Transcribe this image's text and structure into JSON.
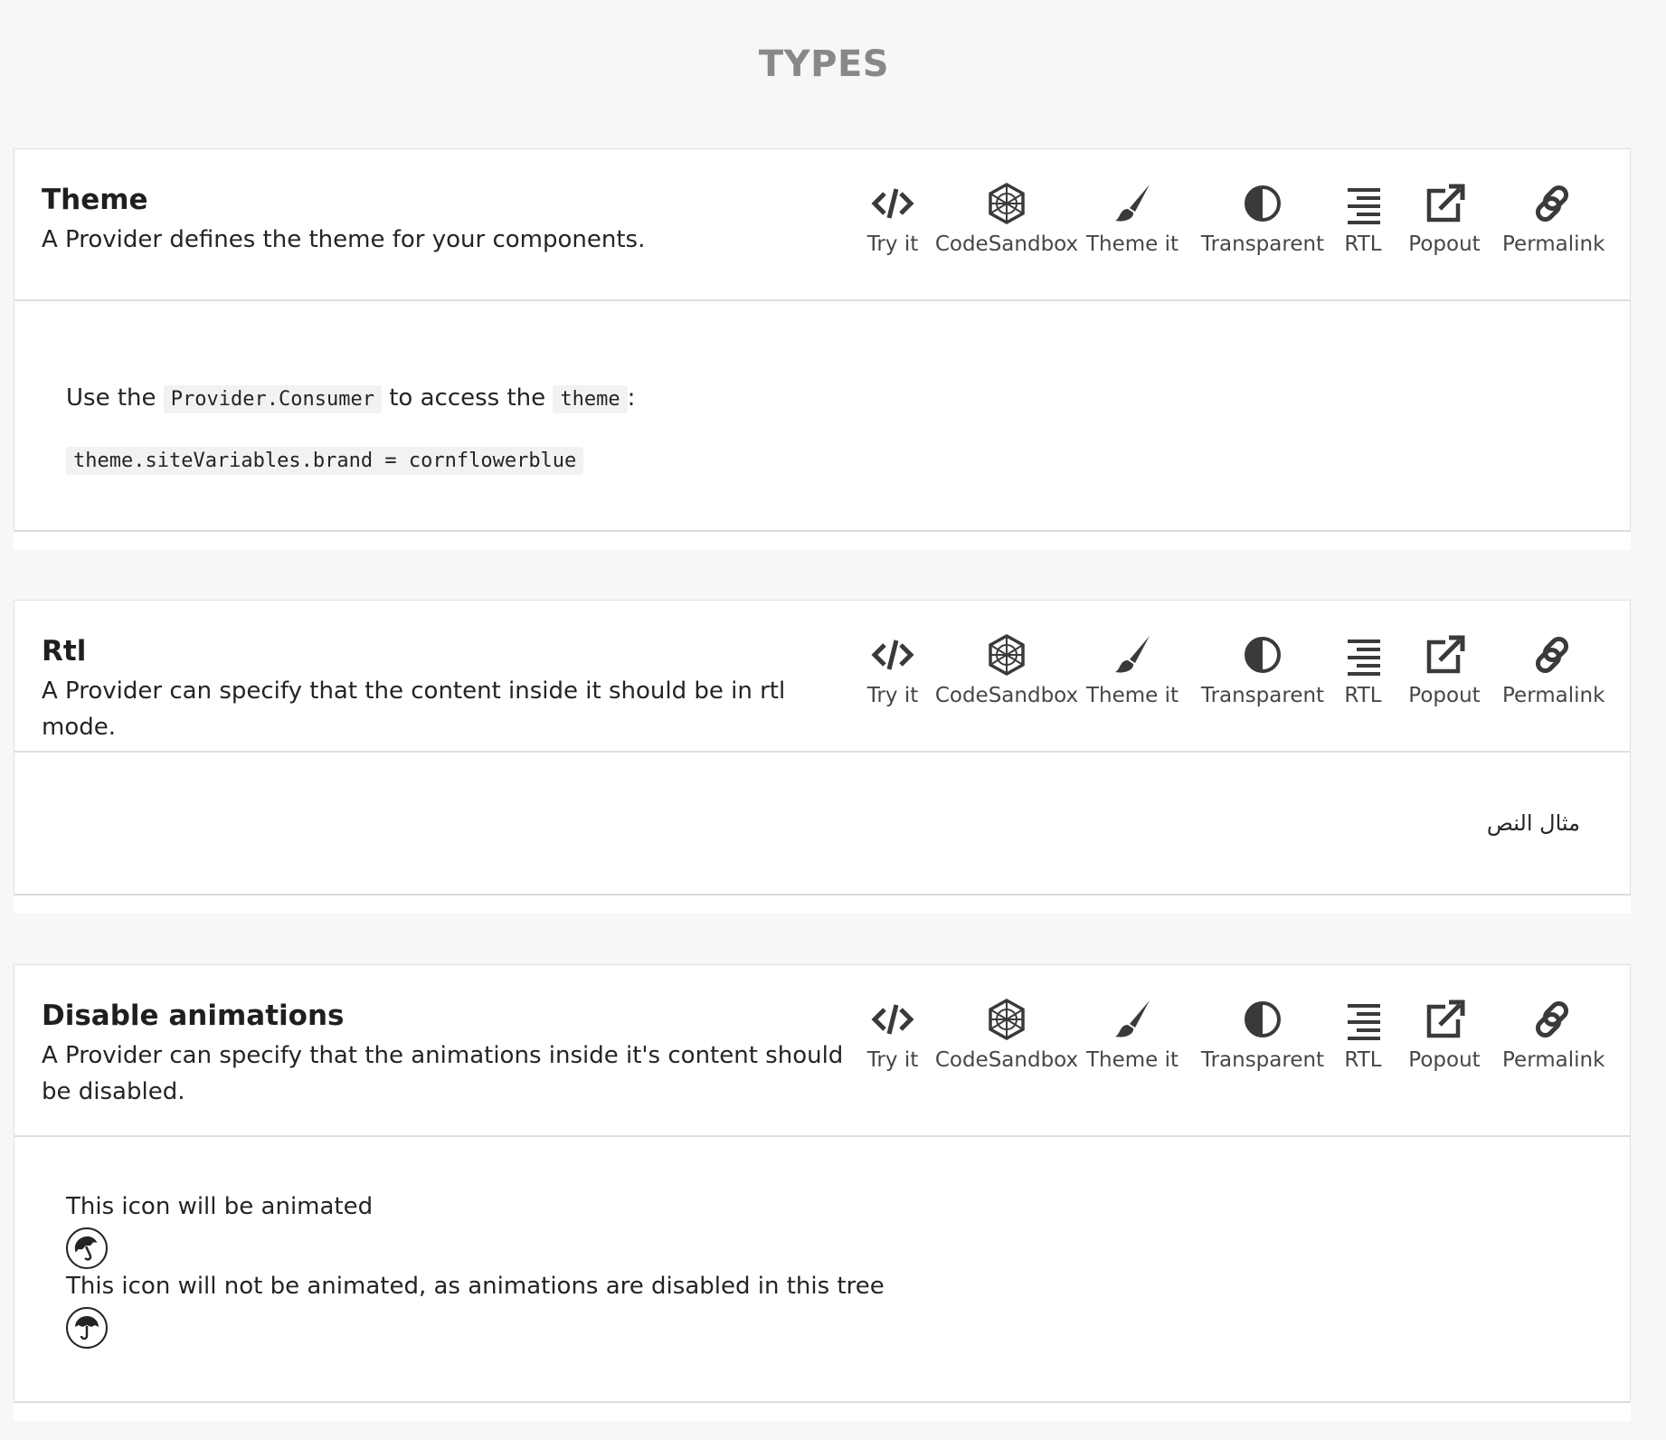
{
  "page": {
    "title": "TYPES"
  },
  "toolbar": {
    "items": [
      {
        "label": "Try it",
        "icon": "code-icon"
      },
      {
        "label": "CodeSandbox",
        "icon": "codesandbox-icon"
      },
      {
        "label": "Theme it",
        "icon": "paint-brush-icon"
      },
      {
        "label": "Transparent",
        "icon": "contrast-icon"
      },
      {
        "label": "RTL",
        "icon": "align-right-icon"
      },
      {
        "label": "Popout",
        "icon": "external-link-icon"
      },
      {
        "label": "Permalink",
        "icon": "link-icon"
      }
    ]
  },
  "examples": [
    {
      "title": "Theme",
      "description": "A Provider defines the theme for your components.",
      "body": {
        "line1_prefix": "Use the",
        "line1_code1": "Provider.Consumer",
        "line1_mid": "to access the",
        "line1_code2": "theme",
        "line1_suffix": ":",
        "code_line": "theme.siteVariables.brand = cornflowerblue"
      }
    },
    {
      "title": "Rtl",
      "description": "A Provider can specify that the content inside it should be in rtl mode.",
      "body": {
        "rtl_text": "مثال النص"
      }
    },
    {
      "title": "Disable animations",
      "description": "A Provider can specify that the animations inside it's content should be disabled.",
      "body": {
        "animated_text": "This icon will be animated",
        "static_text": "This icon will not be animated, as animations are disabled in this tree",
        "animated_icon": "umbrella-icon",
        "static_icon": "umbrella-icon"
      }
    }
  ]
}
